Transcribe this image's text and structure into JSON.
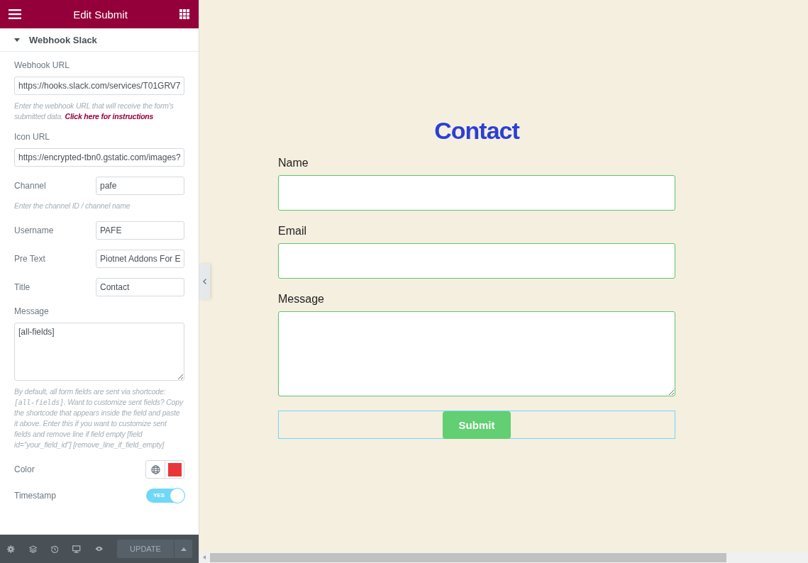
{
  "panel": {
    "title": "Edit Submit",
    "section": {
      "label": "Webhook Slack",
      "expanded": true
    },
    "controls": [
      {
        "kind": "wide",
        "label": "Webhook URL",
        "value": "https://hooks.slack.com/services/T01GRV7",
        "help": [
          {
            "kind": "text",
            "text": "Enter the webhook URL that will receive the form's submitted data. "
          },
          {
            "kind": "link",
            "text": "Click here for instructions"
          }
        ]
      },
      {
        "kind": "wide",
        "label": "Icon URL",
        "value": "https://encrypted-tbn0.gstatic.com/images?"
      },
      {
        "kind": "inline",
        "label": "Channel",
        "value": "pafe",
        "help": [
          {
            "kind": "text",
            "text": "Enter the channel ID / channel name"
          }
        ]
      },
      {
        "kind": "inline",
        "label": "Username",
        "value": "PAFE"
      },
      {
        "kind": "inline",
        "label": "Pre Text",
        "value": "Piotnet Addons For E"
      },
      {
        "kind": "inline",
        "label": "Title",
        "value": "Contact"
      },
      {
        "kind": "textarea",
        "label": "Message",
        "value": "[all-fields]",
        "help": [
          {
            "kind": "text",
            "text": "By default, all form fields are sent via shortcode: "
          },
          {
            "kind": "code",
            "text": "[all-fields]"
          },
          {
            "kind": "text",
            "text": ". Want to customize sent fields? Copy the shortcode that appears inside the field and paste it above. Enter this if you want to customize sent fields and remove line if field empty [field id=\"your_field_id\"] [remove_line_if_field_empty]"
          }
        ]
      },
      {
        "kind": "color",
        "label": "Color",
        "color": "#e8373a"
      },
      {
        "kind": "switch",
        "label": "Timestamp",
        "on": true,
        "switch_text": "YES"
      }
    ]
  },
  "footer": {
    "update_label": "UPDATE"
  },
  "form": {
    "title": "Contact",
    "fields": [
      {
        "kind": "input",
        "label": "Name"
      },
      {
        "kind": "input",
        "label": "Email"
      },
      {
        "kind": "textarea",
        "label": "Message"
      }
    ],
    "submit": "Submit"
  }
}
